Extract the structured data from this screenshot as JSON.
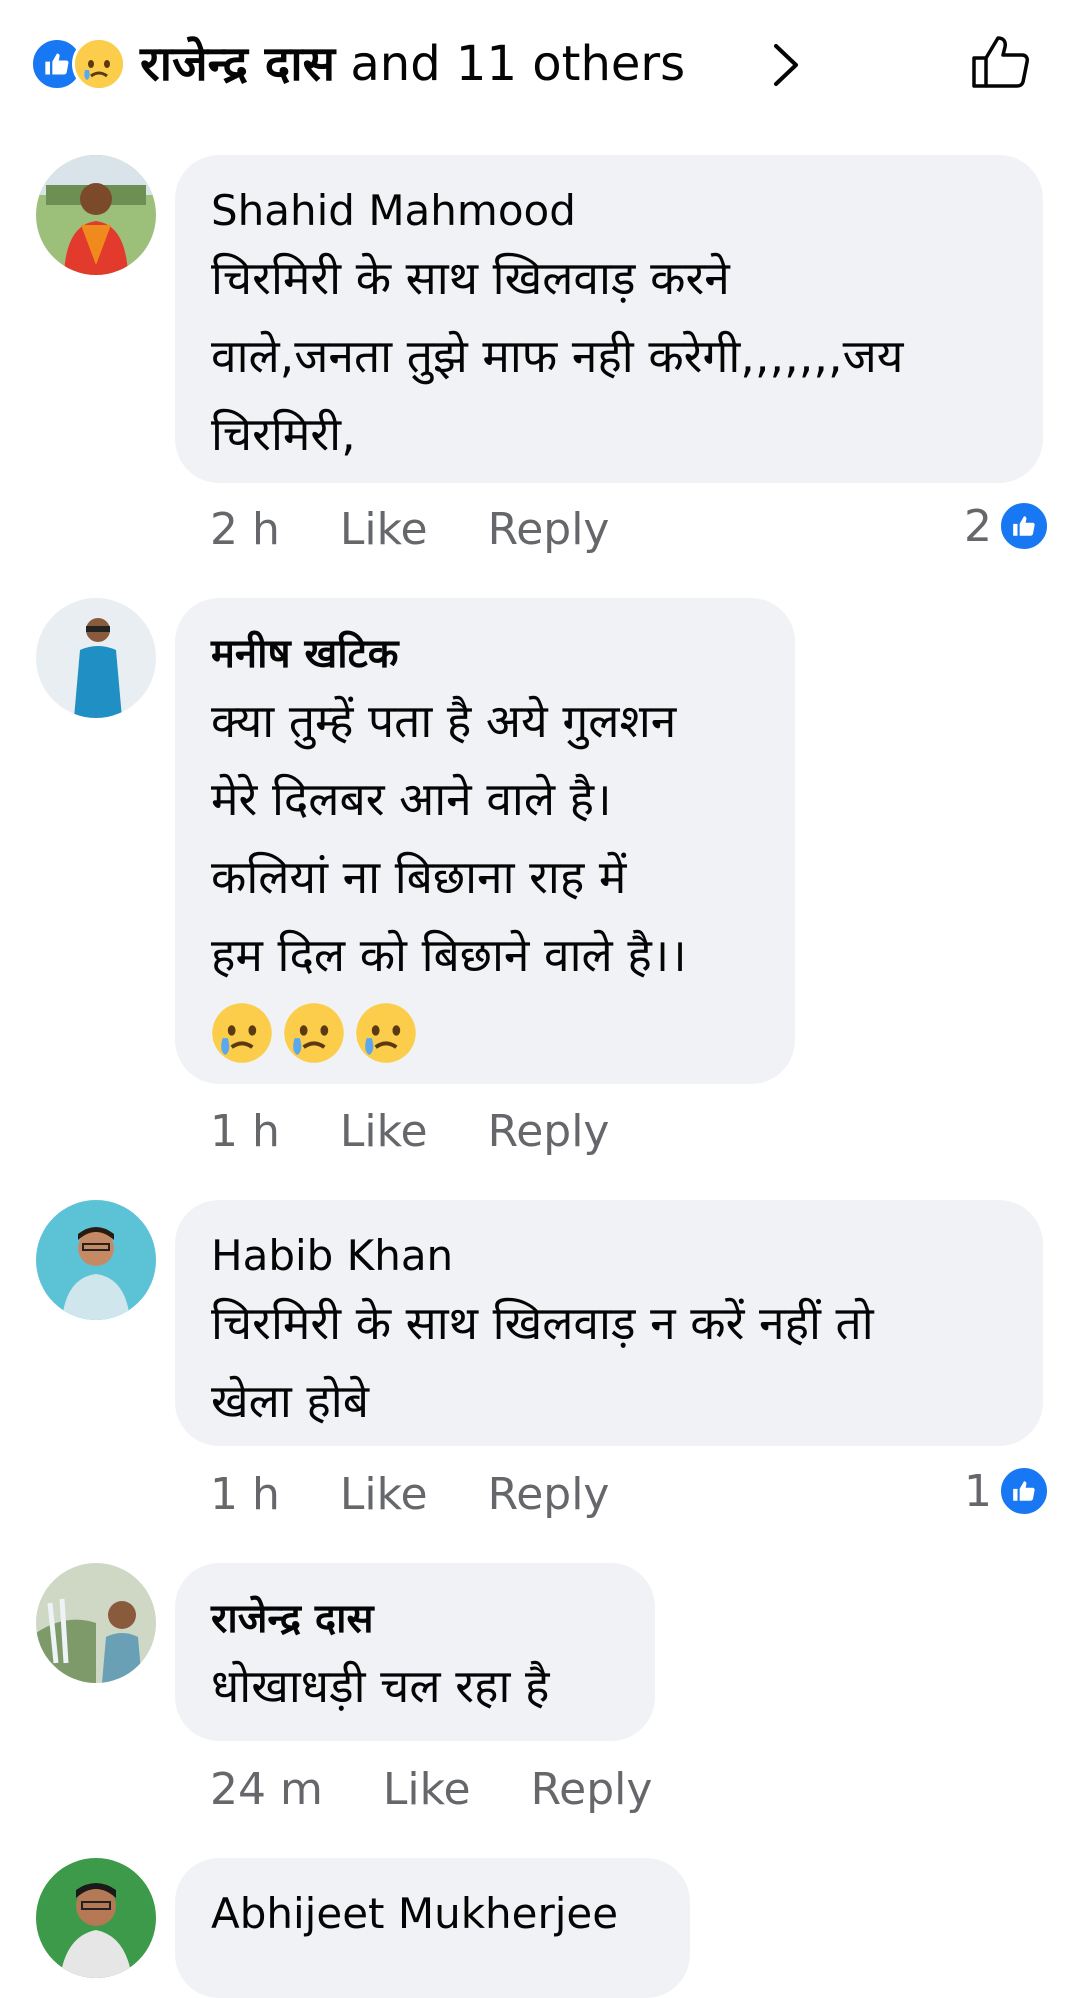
{
  "header": {
    "name": "राजेन्द्र दास",
    "others": " and 11 others",
    "icons": [
      "like-reaction-icon",
      "sad-reaction-icon",
      "chevron-right-icon",
      "thumbs-up-outline-icon"
    ]
  },
  "comments": [
    {
      "author": "Shahid Mahmood",
      "lines": [
        "चिरमिरी के साथ खिलवाड़ करने",
        "वाले,जनता तुझे माफ नही करेगी,,,,,,,जय",
        "चिरमिरी,"
      ],
      "time": "2 h",
      "like": "Like",
      "reply": "Reply",
      "reactions": "2"
    },
    {
      "author": "मनीष खटिक",
      "lines": [
        "क्या तुम्हें पता है अये गुलशन",
        "मेरे दिलबर आने वाले है।",
        "कलियां ना बिछाना राह में",
        "हम दिल को बिछाने वाले है।।"
      ],
      "emojis": [
        "sad-face",
        "sad-face",
        "sad-face"
      ],
      "time": "1 h",
      "like": "Like",
      "reply": "Reply"
    },
    {
      "author": "Habib Khan",
      "lines": [
        "चिरमिरी के साथ खिलवाड़ न करें नहीं तो",
        "खेला होबे"
      ],
      "time": "1 h",
      "like": "Like",
      "reply": "Reply",
      "reactions": "1"
    },
    {
      "author": "राजेन्द्र दास",
      "lines": [
        "धोखाधड़ी चल रहा है"
      ],
      "time": "24 m",
      "like": "Like",
      "reply": "Reply"
    },
    {
      "author": "Abhijeet Mukherjee"
    }
  ],
  "colors": {
    "accent": "#1877f2",
    "bubble": "#f0f2f5",
    "meta": "#65676b"
  }
}
